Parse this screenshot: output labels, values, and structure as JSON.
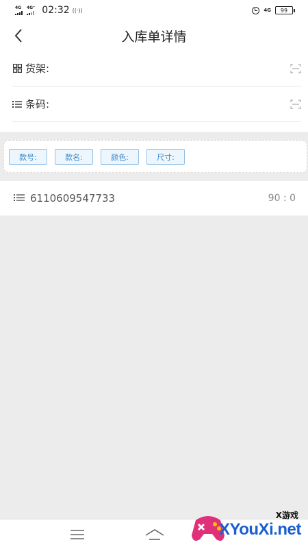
{
  "status_bar": {
    "signal1_label": "4G",
    "signal2_label": "4G⁺",
    "time": "02:32",
    "right_net": "4G",
    "battery": "99"
  },
  "header": {
    "title": "入库单详情"
  },
  "form": {
    "shelf_label": "货架:",
    "shelf_value": "",
    "barcode_label": "条码:",
    "barcode_value": ""
  },
  "filters": {
    "style_no": "款号:",
    "style_name": "款名:",
    "color": "颜色:",
    "size": "尺寸:"
  },
  "list": {
    "items": [
      {
        "code": "6110609547733",
        "qty": "90 : 0"
      }
    ]
  },
  "watermark": {
    "small": "X游戏",
    "big": "XYouXi.net"
  },
  "colors": {
    "accent_border": "#8ec0ea",
    "accent_text": "#3a87c8",
    "background": "#ececec",
    "watermark_blue": "#1a5fd0"
  }
}
